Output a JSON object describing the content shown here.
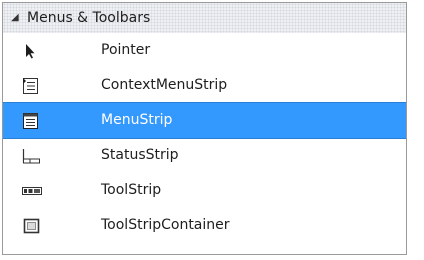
{
  "toolbox": {
    "group_header": {
      "label": "Menus & Toolbars",
      "expanded": true,
      "icon": "collapse-triangle-icon"
    },
    "items": [
      {
        "label": "Pointer",
        "icon": "pointer-arrow-icon",
        "selected": false
      },
      {
        "label": "ContextMenuStrip",
        "icon": "context-menu-strip-icon",
        "selected": false
      },
      {
        "label": "MenuStrip",
        "icon": "menu-strip-icon",
        "selected": true
      },
      {
        "label": "StatusStrip",
        "icon": "status-strip-icon",
        "selected": false
      },
      {
        "label": "ToolStrip",
        "icon": "tool-strip-icon",
        "selected": false
      },
      {
        "label": "ToolStripContainer",
        "icon": "tool-strip-container-icon",
        "selected": false
      }
    ],
    "colors": {
      "selection": "#3399ff",
      "header_background": "#eef0f3",
      "border": "#9a9a9a"
    }
  }
}
